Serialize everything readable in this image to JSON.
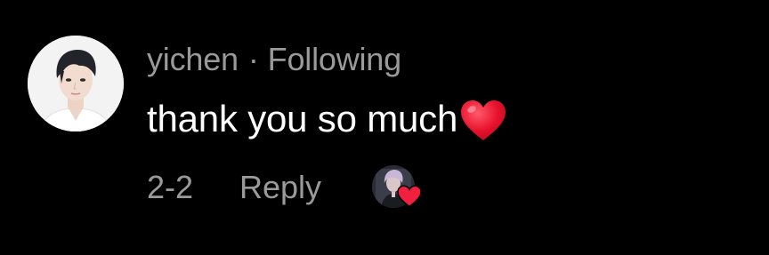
{
  "comment": {
    "username": "yichen",
    "separator": "·",
    "relationship": "Following",
    "text": "thank you so much",
    "date": "2-2",
    "reply_label": "Reply"
  },
  "icons": {
    "avatar": "user-avatar",
    "text_emoji": "red-heart-emoji",
    "creator_like": "creator-liked-heart-icon"
  },
  "colors": {
    "background": "#000000",
    "primary_text": "#ffffff",
    "secondary_text": "#9a9a9a",
    "heart": "#e8112d"
  }
}
